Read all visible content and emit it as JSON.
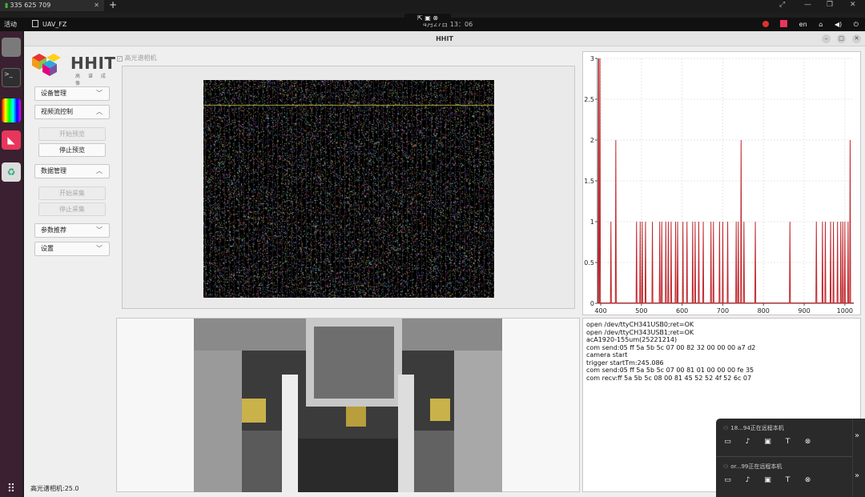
{
  "remote": {
    "tab_label": "335 625 709",
    "plus": "+"
  },
  "topbar": {
    "activities": "活动",
    "app_name": "UAV_FZ",
    "clock": "4月27日 13：06",
    "language": "en"
  },
  "window": {
    "title": "HHIT",
    "logo_text": "HHIT",
    "logo_sub": "高 谱 成 像"
  },
  "sidebar": {
    "hs_checkbox_label": "高光谱相机",
    "device_mgmt": "设备管理",
    "stream_ctrl": "视频流控制",
    "start_preview": "开始预览",
    "stop_preview": "停止预览",
    "data_mgmt": "数据管理",
    "start_capture": "开始采集",
    "stop_capture": "停止采集",
    "param_recommend": "参数推荐",
    "settings": "设置",
    "status": "高光谱相机:25.0"
  },
  "log": {
    "lines": [
      "open /dev/ttyCH341USB0;ret=OK",
      "open /dev/ttyCH343USB1;ret=OK",
      "acA1920-155um(25221214)",
      "com send:05 ff 5a 5b 5c 07 00 82 32 00 00 00 a7 d2",
      "camera start",
      "trigger startTm:245.086",
      "com send:05 ff 5a 5b 5c 07 00 81 01 00 00 00 fe 35",
      "com recv:ff 5a 5b 5c 08 00 81 45 52 52 4f 52 6c 07"
    ]
  },
  "notifications": [
    {
      "user": "18...94正在远程本机"
    },
    {
      "user": "or...99正在远程本机"
    }
  ],
  "chart_data": {
    "type": "line",
    "title": "",
    "xlabel": "",
    "ylabel": "",
    "xlim": [
      392,
      1022
    ],
    "ylim": [
      0,
      3
    ],
    "x_ticks": [
      400,
      500,
      600,
      700,
      800,
      900,
      1000
    ],
    "y_ticks": [
      0,
      0.5,
      1,
      1.5,
      2,
      2.5,
      3
    ],
    "x_tick_labels": [
      "400",
      "500",
      "600",
      "700",
      "800",
      "900",
      "1000"
    ],
    "y_tick_labels": [
      "0",
      "0.5",
      "1",
      "1.5",
      "2",
      "2.5",
      "3"
    ],
    "grid": true,
    "color": "#c0272d",
    "spikes": [
      [
        395,
        3
      ],
      [
        398,
        3
      ],
      [
        425,
        1
      ],
      [
        437,
        2
      ],
      [
        488,
        1
      ],
      [
        497,
        1
      ],
      [
        502,
        1
      ],
      [
        510,
        1
      ],
      [
        527,
        1
      ],
      [
        545,
        1
      ],
      [
        550,
        1
      ],
      [
        560,
        1
      ],
      [
        566,
        1
      ],
      [
        573,
        1
      ],
      [
        584,
        1
      ],
      [
        589,
        1
      ],
      [
        602,
        1
      ],
      [
        612,
        1
      ],
      [
        626,
        1
      ],
      [
        632,
        1
      ],
      [
        641,
        1
      ],
      [
        652,
        1
      ],
      [
        671,
        1
      ],
      [
        677,
        1
      ],
      [
        692,
        1
      ],
      [
        700,
        1
      ],
      [
        712,
        1
      ],
      [
        733,
        1
      ],
      [
        738,
        1
      ],
      [
        745,
        2
      ],
      [
        752,
        1
      ],
      [
        780,
        1
      ],
      [
        865,
        1
      ],
      [
        930,
        1
      ],
      [
        945,
        1
      ],
      [
        952,
        1
      ],
      [
        965,
        1
      ],
      [
        972,
        1
      ],
      [
        982,
        1
      ],
      [
        990,
        1
      ],
      [
        995,
        1
      ],
      [
        1000,
        1
      ],
      [
        1008,
        1
      ],
      [
        1013,
        2
      ]
    ]
  }
}
